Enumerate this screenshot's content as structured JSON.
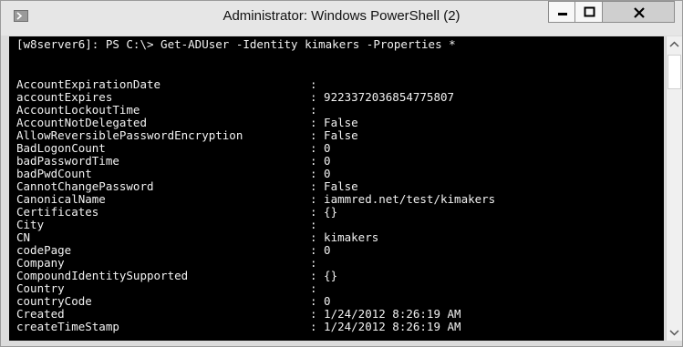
{
  "window": {
    "title": "Administrator: Windows PowerShell (2)",
    "icon": "powershell-icon",
    "controls": {
      "minimize_icon": "minimize-icon",
      "maximize_icon": "maximize-icon",
      "close_icon": "close-icon"
    }
  },
  "console": {
    "prompt_line": "[w8server6]: PS C:\\> Get-ADUser -Identity kimakers -Properties *",
    "properties": [
      {
        "name": "AccountExpirationDate",
        "value": ":"
      },
      {
        "name": "accountExpires",
        "value": ": 9223372036854775807"
      },
      {
        "name": "AccountLockoutTime",
        "value": ":"
      },
      {
        "name": "AccountNotDelegated",
        "value": ": False"
      },
      {
        "name": "AllowReversiblePasswordEncryption",
        "value": ": False"
      },
      {
        "name": "BadLogonCount",
        "value": ": 0"
      },
      {
        "name": "badPasswordTime",
        "value": ": 0"
      },
      {
        "name": "badPwdCount",
        "value": ": 0"
      },
      {
        "name": "CannotChangePassword",
        "value": ": False"
      },
      {
        "name": "CanonicalName",
        "value": ": iammred.net/test/kimakers"
      },
      {
        "name": "Certificates",
        "value": ": {}"
      },
      {
        "name": "City",
        "value": ":"
      },
      {
        "name": "CN",
        "value": ": kimakers"
      },
      {
        "name": "codePage",
        "value": ": 0"
      },
      {
        "name": "Company",
        "value": ":"
      },
      {
        "name": "CompoundIdentitySupported",
        "value": ": {}"
      },
      {
        "name": "Country",
        "value": ":"
      },
      {
        "name": "countryCode",
        "value": ": 0"
      },
      {
        "name": "Created",
        "value": ": 1/24/2012 8:26:19 AM"
      },
      {
        "name": "createTimeStamp",
        "value": ": 1/24/2012 8:26:19 AM"
      }
    ]
  },
  "scrollbar": {
    "up_icon": "scroll-up-arrow-icon",
    "down_icon": "scroll-down-arrow-icon"
  }
}
